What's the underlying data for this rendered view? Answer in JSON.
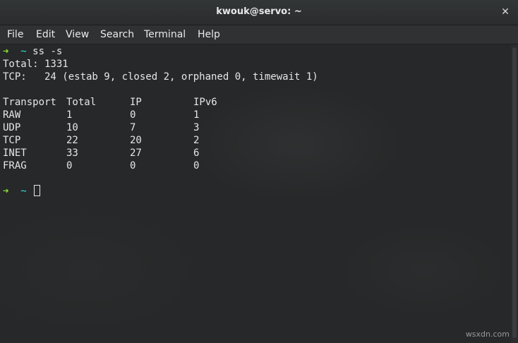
{
  "window": {
    "title": "kwouk@servo: ~",
    "close_glyph": "✕"
  },
  "menu": [
    "File",
    "Edit",
    "View",
    "Search",
    "Terminal",
    "Help"
  ],
  "terminal": {
    "prompt_arrow": "➜",
    "prompt_dir": "~",
    "command": "ss -s",
    "total_line": "Total: 1331",
    "tcp_line": "TCP:   24 (estab 9, closed 2, orphaned 0, timewait 1)",
    "table": {
      "header": [
        "Transport",
        "Total",
        "IP",
        "IPv6"
      ],
      "rows": [
        [
          "RAW",
          "1",
          "0",
          "1"
        ],
        [
          "UDP",
          "10",
          "7",
          "3"
        ],
        [
          "TCP",
          "22",
          "20",
          "2"
        ],
        [
          "INET",
          "33",
          "27",
          "6"
        ],
        [
          "FRAG",
          "0",
          "0",
          "0"
        ]
      ]
    }
  },
  "watermark": "wsxdn.com",
  "colors": {
    "prompt_arrow": "#8ae234",
    "prompt_dir": "#34e2e2",
    "background": "#262829",
    "text": "#e6e6e6"
  }
}
